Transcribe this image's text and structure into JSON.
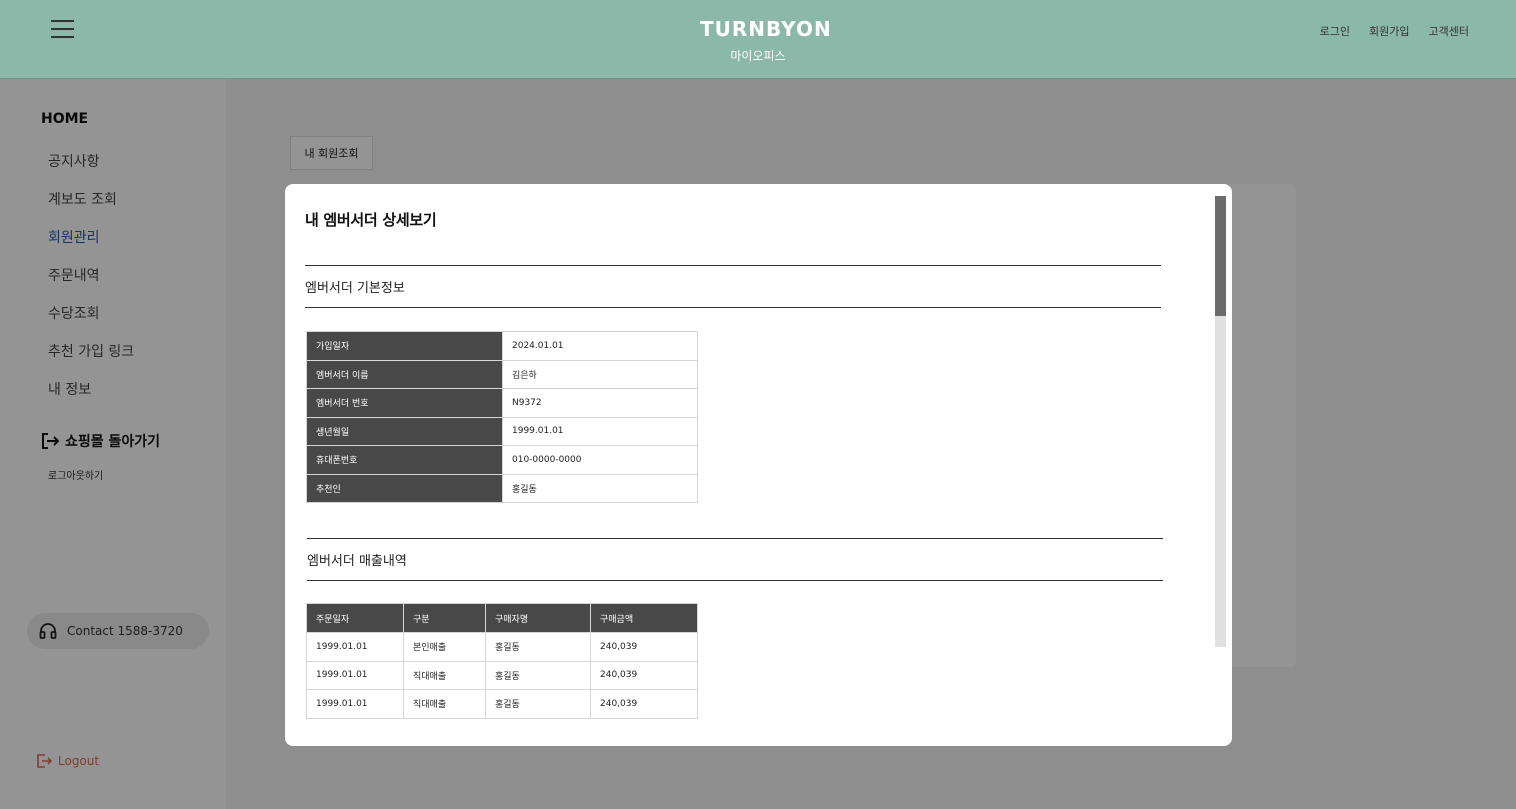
{
  "header": {
    "logo": "TURNBYON",
    "subtitle": "마이오피스",
    "links": [
      "로그인",
      "회원가입",
      "고객센터"
    ]
  },
  "sidebar": {
    "home": "HOME",
    "items": [
      {
        "label": "공지사항"
      },
      {
        "label": "계보도 조회"
      },
      {
        "label": "회원관리"
      },
      {
        "label": "주문내역"
      },
      {
        "label": "수당조회"
      },
      {
        "label": "추천 가입 링크"
      },
      {
        "label": "내 정보"
      }
    ],
    "back_label": "쇼핑몰 돌아가기",
    "logout_small": "로그아웃하기",
    "contact": "Contact 1588-3720",
    "logout": "Logout"
  },
  "main": {
    "my_button": "내 회원조회"
  },
  "modal": {
    "title": "내 엠버서더 상세보기",
    "basic_section": "엠버서더 기본정보",
    "basic_info": [
      {
        "k": "가입일자",
        "v": "2024.01.01"
      },
      {
        "k": "엠버서더 이름",
        "v": "김은하"
      },
      {
        "k": "엠버서더 번호",
        "v": "N9372"
      },
      {
        "k": "생년월일",
        "v": "1999.01.01"
      },
      {
        "k": "휴대폰번호",
        "v": "010-0000-0000"
      },
      {
        "k": "추천인",
        "v": "홍길동"
      }
    ],
    "sales_section": "엠버서더 매출내역",
    "sales_headers": [
      "주문일자",
      "구분",
      "구매자명",
      "구매금액"
    ],
    "sales_rows": [
      [
        "1999.01.01",
        "본인매출",
        "홍길동",
        "240,039"
      ],
      [
        "1999.01.01",
        "직대매출",
        "홍길동",
        "240,039"
      ],
      [
        "1999.01.01",
        "직대매출",
        "홍길동",
        "240,039"
      ]
    ]
  },
  "colors": {
    "header_bg": "#8bb8a8",
    "active_nav": "#2a5aa8",
    "table_header": "#484848",
    "logout": "#e06a5a"
  }
}
